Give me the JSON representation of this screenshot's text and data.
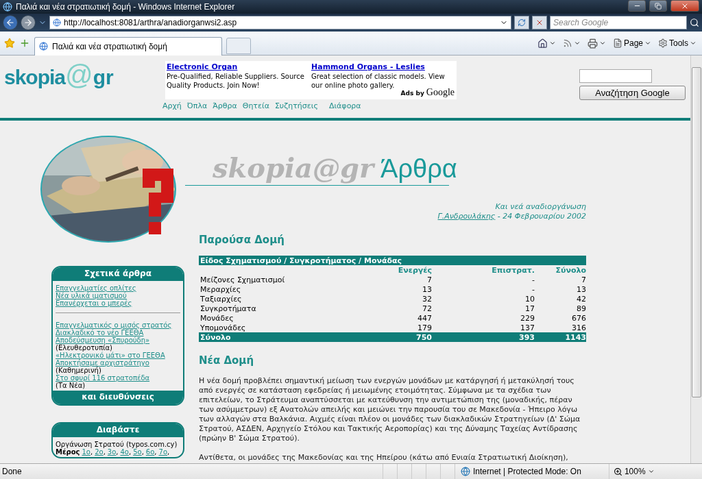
{
  "window": {
    "title": "Παλιά και νέα στρατιωτική δομή - Windows Internet Explorer"
  },
  "address_bar": {
    "url": "http://localhost:8081/arthra/anadiorganwsi2.asp",
    "search_placeholder": "Search Google"
  },
  "tabs": [
    {
      "label": "Παλιά και νέα στρατιωτική δομή",
      "selected": true
    }
  ],
  "command_bar": {
    "page": "Page",
    "tools": "Tools"
  },
  "logo": {
    "name": "skopia",
    "at": "@",
    "suffix": "gr"
  },
  "ads": {
    "items": [
      {
        "title": "Electronic Organ",
        "text": "Pre-Qualified, Reliable Suppliers. Source Quality Products. Join Now!"
      },
      {
        "title": "Hammond Organs - Leslies",
        "text": "Great selection of classic models. View our online photo gallery."
      }
    ],
    "label": "Ads by",
    "brand": "Google"
  },
  "google_search": {
    "button": "Αναζήτηση Google"
  },
  "nav": [
    "Αρχή",
    "Όπλα",
    "Άρθρα",
    "Θητεία",
    "Συζητήσεις",
    "Διάφορα"
  ],
  "section_title": "Άρθρα",
  "watermark": "skopia@gr",
  "byline": {
    "subtitle": "Και νεά αναδιοργάνωση",
    "author": "Γ.Ανδρουλάκης",
    "date": " - 24 Φεβρουαρίου 2002"
  },
  "related": {
    "title": "Σχετικά άρθρα",
    "groups": [
      [
        {
          "kind": "link",
          "text": "Επαγγελματίες οπλίτες"
        },
        {
          "kind": "link",
          "text": "Νέα υλικά ιματισμού"
        },
        {
          "kind": "link",
          "text": "Επανέρχεται ο μπερές"
        }
      ],
      [
        {
          "kind": "link",
          "text": "Επαγγελματικός ο μισός στρατός"
        },
        {
          "kind": "link",
          "text": "Διακλαδικό το νέο ΓΕΕΘΑ"
        },
        {
          "kind": "link",
          "text": "Αποδεύσμευση «Σπυρούδη»"
        },
        {
          "kind": "source",
          "text": "(Ελευθεροτυπία)"
        },
        {
          "kind": "link",
          "text": "«Ηλεκτρονικό μάτι» στο ΓΕΕΘΑ"
        },
        {
          "kind": "link",
          "text": "Αποκτήσαμε αρχιστράτηγο"
        },
        {
          "kind": "source",
          "text": "(Καθημερινή)"
        },
        {
          "kind": "link",
          "text": "Στο σφυρί 116 στρατοπέδα"
        },
        {
          "kind": "source",
          "text": "(Τα Νέα)"
        }
      ]
    ],
    "footer": "και διευθύνσεις"
  },
  "read": {
    "title": "Διαβάστε",
    "source": "Οργάνωση Στρατού (typos.com.cy)",
    "parts_label": "Μέρος",
    "parts": [
      {
        "kind": "link",
        "text": "1ο"
      },
      {
        "kind": "plain",
        "text": ","
      },
      {
        "kind": "link",
        "text": "2ο"
      },
      {
        "kind": "plain",
        "text": ","
      },
      {
        "kind": "link",
        "text": "3ο"
      },
      {
        "kind": "plain",
        "text": ","
      },
      {
        "kind": "link",
        "text": "4ο"
      },
      {
        "kind": "plain",
        "text": ","
      },
      {
        "kind": "link",
        "text": "5ο"
      },
      {
        "kind": "plain",
        "text": ","
      },
      {
        "kind": "link",
        "text": "6ο"
      },
      {
        "kind": "plain",
        "text": ","
      },
      {
        "kind": "link",
        "text": "7ο"
      },
      {
        "kind": "plain",
        "text": ","
      }
    ]
  },
  "current_heading": "Παρούσα Δομή",
  "table": {
    "caption": "Είδος Σχηματισμού / Συγκροτήματος / Μονάδας",
    "columns": [
      "",
      "Ενεργές",
      "Επιστρατ.",
      "Σύνολο"
    ],
    "rows": [
      [
        "Μείζονες Σχηματισμοί",
        "7",
        "-",
        "7"
      ],
      [
        "Μεραρχίες",
        "13",
        "-",
        "13"
      ],
      [
        "Ταξιαρχίες",
        "32",
        "10",
        "42"
      ],
      [
        "Συγκροτήματα",
        "72",
        "17",
        "89"
      ],
      [
        "Μονάδες",
        "447",
        "229",
        "676"
      ],
      [
        "Υπομονάδες",
        "179",
        "137",
        "316"
      ]
    ],
    "total": [
      "Σύνολο",
      "750",
      "393",
      "1143"
    ]
  },
  "new_heading": "Νέα Δομή",
  "paragraphs": [
    "Η νέα δομή προβλέπει σημαντική μείωση των ενεργών μονάδων με κατάργησή ή μετακύλησή τους από ενεργές σε κατάσταση εφεδρείας ή μειωμένης ετοιμότητας. Σύμφωνα με τα σχέδια των επιτελείων, το Στράτευμα αναπτύσσεται με κατεύθυνση την αντιμετώπιση της (μοναδικής, πέραν των ασύμμετρων) εξ Ανατολών απειλής και μειώνει την παρουσία του σε Μακεδονία - Ήπειρο λόγω των αλλαγών στα Βαλκάνια. Αιχμές είναι πλέον οι μονάδες των διακλαδικών Στρατηγείων (Δ' Σώμα Στρατού, ΑΣΔΕΝ, Αρχηγείο Στόλου και Τακτικής Αεροπορίας) και της Δύναμης Ταχείας Αντίδρασης (πρώην Β' Σώμα Στρατού).",
    "Αντίθετα, οι μονάδες της Μακεδονίας και της Ηπείρου (κάτω από Ενιαία Στρατιωτική Διοίκηση),"
  ],
  "status_bar": {
    "text": "Done",
    "zone": "Internet | Protected Mode: On",
    "zoom": "100%"
  }
}
